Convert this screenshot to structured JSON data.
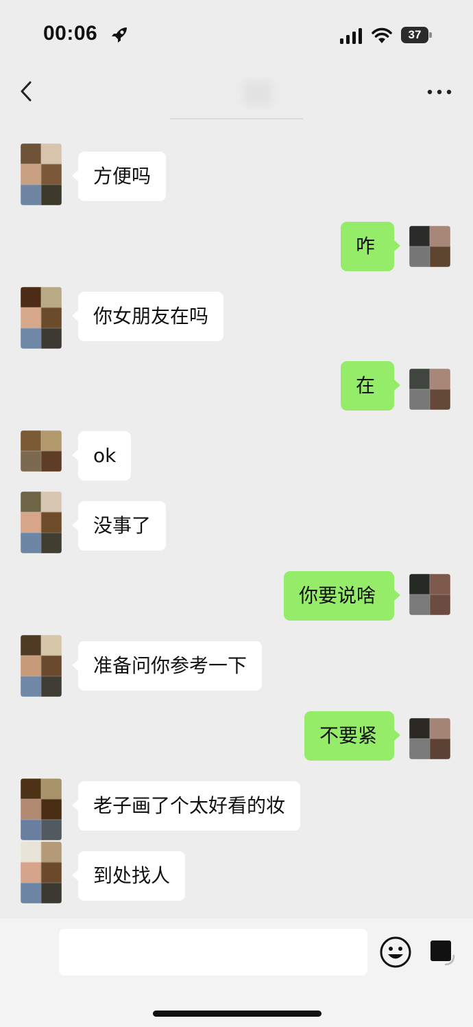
{
  "status_bar": {
    "time": "00:06",
    "battery": "37",
    "icons": [
      "rocket-icon",
      "signal-icon",
      "wifi-icon",
      "battery-icon"
    ]
  },
  "nav": {
    "icons": [
      "back-chevron-icon",
      "more-icon"
    ]
  },
  "colors": {
    "background": "#ededed",
    "incoming_bubble": "#ffffff",
    "outgoing_bubble": "#95ec69",
    "input_area": "#f3f3f3"
  },
  "messages": [
    {
      "side": "in",
      "text": "方便吗"
    },
    {
      "side": "out",
      "text": "咋"
    },
    {
      "side": "in",
      "text": "你女朋友在吗"
    },
    {
      "side": "out",
      "text": "在"
    },
    {
      "side": "in",
      "text": "ok"
    },
    {
      "side": "in",
      "text": "没事了"
    },
    {
      "side": "out",
      "text": "你要说啥"
    },
    {
      "side": "in",
      "text": "准备问你参考一下"
    },
    {
      "side": "out",
      "text": "不要紧"
    },
    {
      "side": "in",
      "text": "老子画了个太好看的妆"
    },
    {
      "side": "in",
      "text": "到处找人"
    }
  ],
  "input_bar": {
    "value": "",
    "icons": [
      "emoji-icon",
      "more-input-icon"
    ]
  }
}
